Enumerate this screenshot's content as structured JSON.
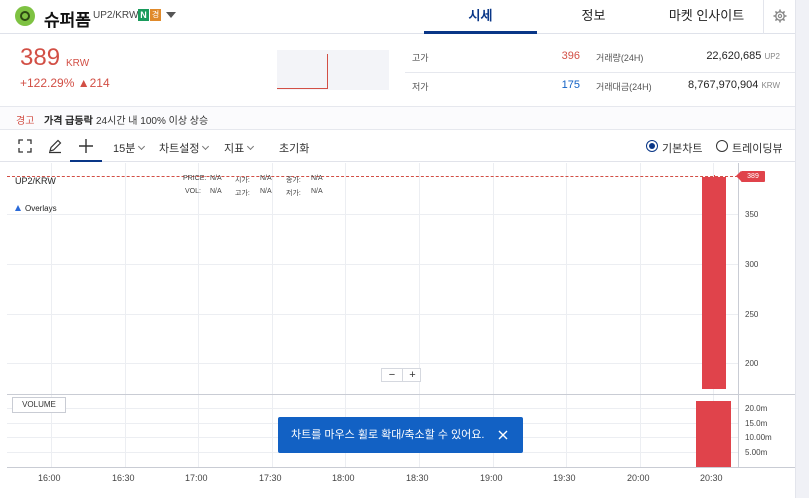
{
  "header": {
    "coin_name": "슈퍼폼",
    "pair": "UP2/KRW",
    "badge_n": "N",
    "badge_w": "경",
    "tabs": [
      {
        "label": "시세",
        "active": true
      },
      {
        "label": "정보",
        "active": false
      },
      {
        "label": "마켓 인사이트",
        "active": false
      }
    ]
  },
  "summary": {
    "price": "389",
    "unit": "KRW",
    "change_pct": "+122.29%",
    "change_abs": "▲214",
    "high_label": "고가",
    "high_value": "396",
    "low_label": "저가",
    "low_value": "175",
    "volume_label": "거래량(24H)",
    "volume_value": "22,620,685",
    "volume_unit": "UP2",
    "amount_label": "거래대금(24H)",
    "amount_value": "8,767,970,904",
    "amount_unit": "KRW"
  },
  "warning": {
    "tag": "경고",
    "title": "가격 급등락",
    "desc": "24시간 내 100% 이상 상승"
  },
  "toolbar": {
    "interval": "15분",
    "chart_settings": "차트설정",
    "indicator": "지표",
    "reset": "초기화",
    "basic_chart": "기본차트",
    "tradingview": "트레이딩뷰"
  },
  "chart": {
    "pair_label": "UP2/KRW",
    "overlays": "Overlays",
    "ohlc": {
      "price_lbl": "PRICE",
      "price_val": "N/A",
      "open_lbl": "시가",
      "open_val": "N/A",
      "close_lbl": "종가",
      "close_val": "N/A",
      "vol_lbl": "VOL",
      "vol_val": "N/A",
      "high_lbl": "고가",
      "high_val": "N/A",
      "low_lbl": "저가",
      "low_val": "N/A"
    },
    "last_price_tag": "389",
    "price_ticks": [
      "350",
      "300",
      "250",
      "200"
    ],
    "volume_label": "VOLUME",
    "volume_ticks": [
      "20.0m",
      "15.0m",
      "10.00m",
      "5.00m"
    ],
    "time_ticks": [
      "16:00",
      "16:30",
      "17:00",
      "17:30",
      "18:00",
      "18:30",
      "19:00",
      "19:30",
      "20:00",
      "20:30"
    ],
    "zoom_minus": "−",
    "zoom_plus": "+"
  },
  "toast": {
    "message": "차트를 마우스 휠로 확대/축소할 수 있어요."
  },
  "colors": {
    "accent": "#093687",
    "up": "#d24f45",
    "candle": "#e0434b",
    "toast": "#1261c4"
  }
}
